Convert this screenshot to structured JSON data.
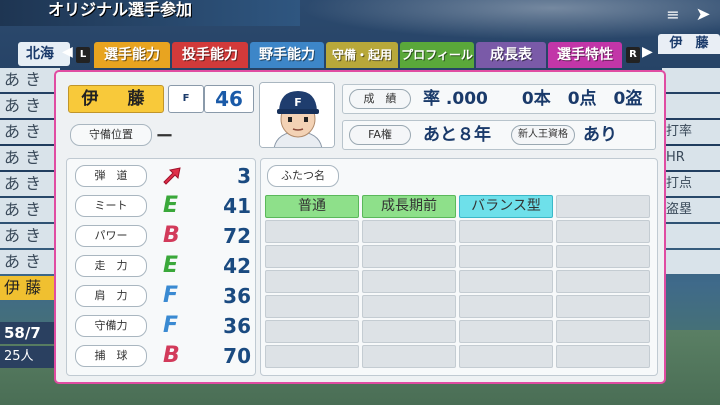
{
  "header": {
    "title": "オリジナル選手参加",
    "top_right_icon": "arrow-icon"
  },
  "tabs": {
    "team": "北海",
    "left_button": "L",
    "right_button": "R",
    "items": [
      {
        "label": "選手能力",
        "color": "#e8a420"
      },
      {
        "label": "投手能力",
        "color": "#d23a3a"
      },
      {
        "label": "野手能力",
        "color": "#3d86c8"
      },
      {
        "label": "守備・起用",
        "color": "#b8a83a"
      },
      {
        "label": "プロフィール",
        "color": "#5aa83a"
      },
      {
        "label": "成長表",
        "color": "#7a5aa8"
      },
      {
        "label": "選手特性",
        "color": "#c236a8"
      }
    ],
    "extra": "伊　藤"
  },
  "roster_left": {
    "rows": [
      "あ き",
      "あ き",
      "あ き",
      "あ き",
      "あ き",
      "あ き",
      "あ き",
      "あ き"
    ],
    "selected": "伊 藤",
    "footer_count": "58/7",
    "footer_people": "25人"
  },
  "roster_right": {
    "rows": [
      "",
      "",
      "",
      "",
      "",
      "",
      "",
      ""
    ],
    "stat_labels": [
      "打率",
      "HR",
      "打点",
      "盗塁"
    ]
  },
  "player": {
    "name": "伊　藤",
    "team_logo": "F",
    "number": "46",
    "position_label": "守備位置",
    "position_value": "ー"
  },
  "record": {
    "label": "成　績",
    "text": "率 .000　　0本　0点　0盗"
  },
  "fa": {
    "label": "FA権",
    "text": "あと８年",
    "rookie_label": "新人王資格",
    "rookie_value": "あり"
  },
  "stats": [
    {
      "label": "弾　道",
      "grade": "",
      "value": "3",
      "icon": "trajectory-arrow-icon"
    },
    {
      "label": "ミート",
      "grade": "E",
      "value": "41",
      "color": "#3aa83a"
    },
    {
      "label": "パワー",
      "grade": "B",
      "value": "72",
      "color": "#d23a5a"
    },
    {
      "label": "走　力",
      "grade": "E",
      "value": "42",
      "color": "#3aa83a"
    },
    {
      "label": "肩　力",
      "grade": "F",
      "value": "36",
      "color": "#3a8ad2"
    },
    {
      "label": "守備力",
      "grade": "F",
      "value": "36",
      "color": "#3a8ad2"
    },
    {
      "label": "捕　球",
      "grade": "B",
      "value": "70",
      "color": "#d23a5a"
    }
  ],
  "abilities": {
    "nickname_label": "ふたつ名",
    "items": [
      {
        "label": "普通",
        "style": "green"
      },
      {
        "label": "成長期前",
        "style": "green"
      },
      {
        "label": "バランス型",
        "style": "cyan"
      },
      {
        "label": "",
        "style": ""
      },
      {
        "label": "",
        "style": ""
      },
      {
        "label": "",
        "style": ""
      },
      {
        "label": "",
        "style": ""
      },
      {
        "label": "",
        "style": ""
      },
      {
        "label": "",
        "style": ""
      },
      {
        "label": "",
        "style": ""
      },
      {
        "label": "",
        "style": ""
      },
      {
        "label": "",
        "style": ""
      },
      {
        "label": "",
        "style": ""
      },
      {
        "label": "",
        "style": ""
      },
      {
        "label": "",
        "style": ""
      },
      {
        "label": "",
        "style": ""
      },
      {
        "label": "",
        "style": ""
      },
      {
        "label": "",
        "style": ""
      },
      {
        "label": "",
        "style": ""
      },
      {
        "label": "",
        "style": ""
      },
      {
        "label": "",
        "style": ""
      },
      {
        "label": "",
        "style": ""
      },
      {
        "label": "",
        "style": ""
      },
      {
        "label": "",
        "style": ""
      },
      {
        "label": "",
        "style": ""
      },
      {
        "label": "",
        "style": ""
      },
      {
        "label": "",
        "style": ""
      },
      {
        "label": "",
        "style": ""
      }
    ]
  }
}
